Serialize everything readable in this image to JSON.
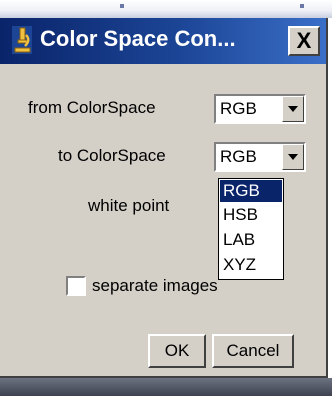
{
  "window": {
    "title": "Color Space Con...",
    "close_label": "X"
  },
  "form": {
    "from_label": "from ColorSpace",
    "from_value": "RGB",
    "to_label": "to ColorSpace",
    "to_value": "RGB",
    "white_point_label": "white point",
    "separate_images_label": "separate images",
    "separate_images_checked": false
  },
  "dropdown": {
    "items": [
      "RGB",
      "HSB",
      "LAB",
      "XYZ"
    ],
    "selected": "RGB"
  },
  "buttons": {
    "ok_label": "OK",
    "cancel_label": "Cancel"
  },
  "colors": {
    "title_bar_start": "#0a246a",
    "title_bar_end": "#3a6fc8",
    "dialog_background": "#d4d0c8",
    "selection_highlight": "#0a246a"
  },
  "icons": {
    "app_icon": "microscope-icon",
    "close_icon": "close-icon",
    "dropdown_arrow": "chevron-down-icon"
  }
}
